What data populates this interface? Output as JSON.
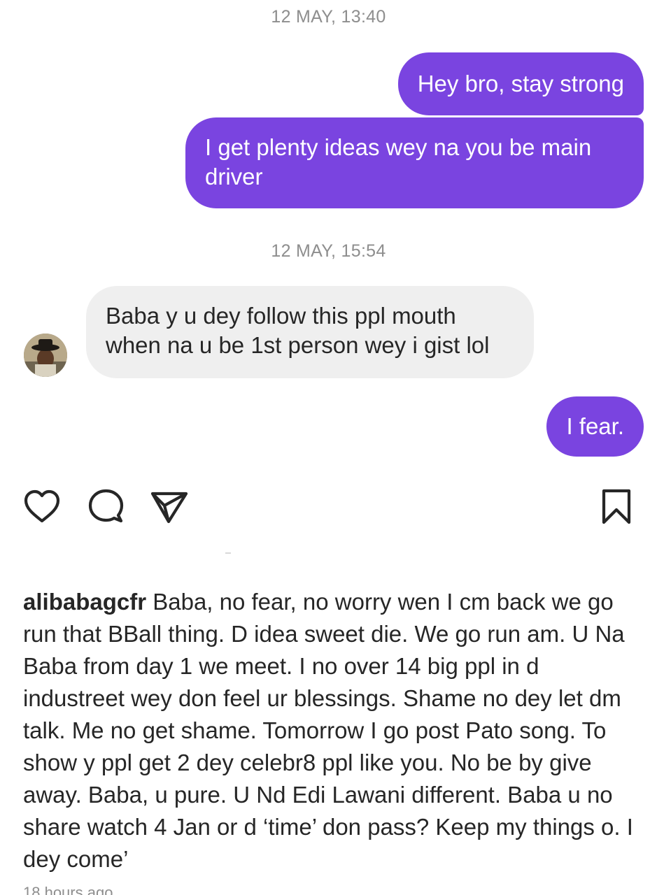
{
  "thread": {
    "timestamp_1": "12 MAY, 13:40",
    "msg_1": "Hey bro, stay strong",
    "msg_2": "I get plenty ideas wey na you be main driver",
    "timestamp_2": "12 MAY, 15:54",
    "msg_3": "Baba y u dey follow this ppl mouth when na u be 1st person wey i gist lol",
    "msg_4": "I fear.",
    "outgoing_color": "#7a44e0",
    "incoming_color": "#efefef"
  },
  "actions": {
    "like_icon": "heart-icon",
    "comment_icon": "comment-icon",
    "share_icon": "send-icon",
    "save_icon": "bookmark-icon"
  },
  "caption": {
    "username": "alibabagcfr",
    "text": "Baba, no fear, no worry wen I cm back we go run that BBall thing. D idea sweet die. We go run am. U Na Baba from day 1 we meet. I no over 14 big ppl in d industreet wey don feel ur blessings. Shame no dey let dm talk. Me no get shame. Tomorrow I go post Pato song. To show y ppl get 2 dey celebr8 ppl like you. No be by give away. Baba, u pure. U Nd Edi Lawani different. Baba u no share watch 4 Jan or d ‘time’ don pass? Keep my things o. I dey come’",
    "time_ago": "18 hours ago"
  }
}
